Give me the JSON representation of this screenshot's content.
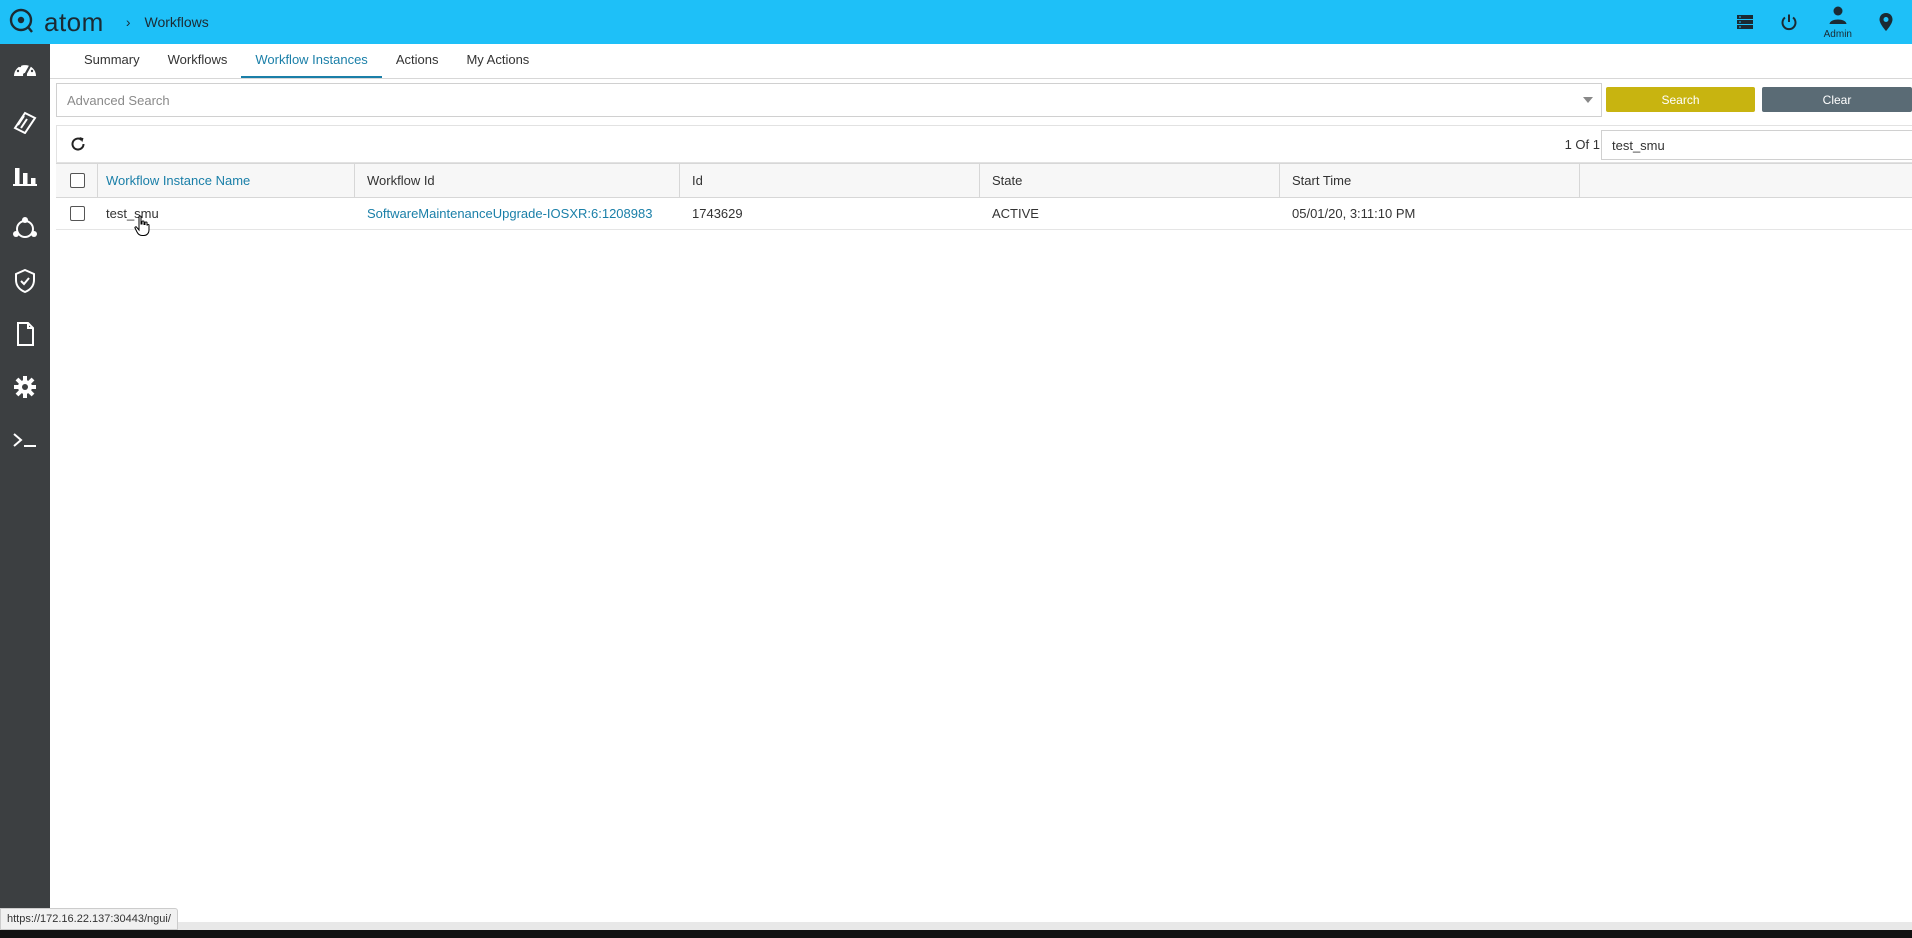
{
  "header": {
    "brand": "atom",
    "breadcrumb_sep": "›",
    "breadcrumb": "Workflows",
    "icons": [
      "server-icon",
      "power-icon",
      "user-icon",
      "location-pin-icon"
    ],
    "user_label": "Admin"
  },
  "sidebar": {
    "items": [
      "dashboard-icon",
      "devices-icon",
      "analytics-icon",
      "topology-icon",
      "compliance-icon",
      "documents-icon",
      "settings-icon",
      "terminal-icon"
    ]
  },
  "tabs": [
    {
      "label": "Summary"
    },
    {
      "label": "Workflows"
    },
    {
      "label": "Workflow Instances",
      "active": true
    },
    {
      "label": "Actions"
    },
    {
      "label": "My Actions"
    }
  ],
  "search": {
    "placeholder": "Advanced Search",
    "search_label": "Search",
    "clear_label": "Clear"
  },
  "grid": {
    "pager": "1 Of 1",
    "filter_value": "test_smu",
    "filter_clear": "✕",
    "columns": [
      "Workflow Instance Name",
      "Workflow Id",
      "Id",
      "State",
      "Start Time"
    ],
    "rows": [
      {
        "name": "test_smu",
        "workflow_id": "SoftwareMaintenanceUpgrade-IOSXR:6:1208983",
        "id": "1743629",
        "state": "ACTIVE",
        "start_time": "05/01/20, 3:11:10 PM"
      }
    ]
  },
  "statusbar": {
    "url": "https://172.16.22.137:30443/ngui/"
  },
  "colors": {
    "topbar": "#1ec0f8",
    "sidebar": "#3c3f41",
    "accent": "#1a7fa8",
    "search_button": "#c8b410",
    "clear_button": "#5a6b75"
  }
}
